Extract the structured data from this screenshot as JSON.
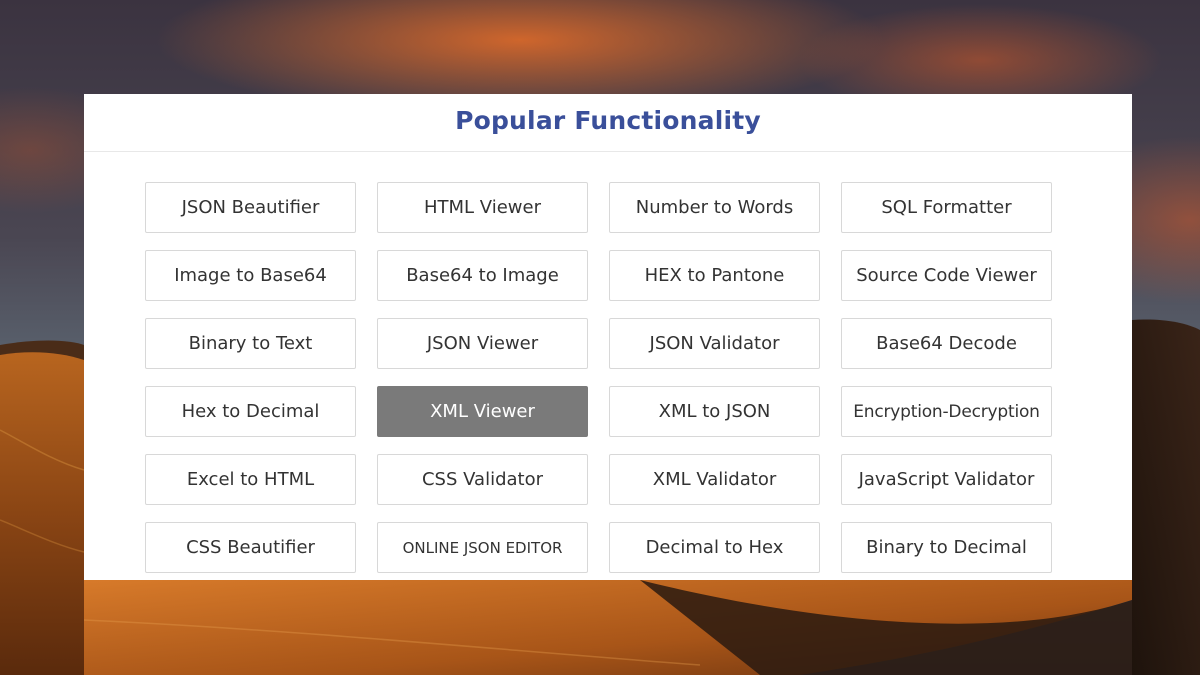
{
  "panel": {
    "title": "Popular Functionality"
  },
  "buttons": [
    {
      "label": "JSON Beautifier",
      "name": "json-beautifier-button"
    },
    {
      "label": "HTML Viewer",
      "name": "html-viewer-button"
    },
    {
      "label": "Number to Words",
      "name": "number-to-words-button"
    },
    {
      "label": "SQL Formatter",
      "name": "sql-formatter-button"
    },
    {
      "label": "Image to Base64",
      "name": "image-to-base64-button"
    },
    {
      "label": "Base64 to Image",
      "name": "base64-to-image-button"
    },
    {
      "label": "HEX to Pantone",
      "name": "hex-to-pantone-button"
    },
    {
      "label": "Source Code Viewer",
      "name": "source-code-viewer-button"
    },
    {
      "label": "Binary to Text",
      "name": "binary-to-text-button"
    },
    {
      "label": "JSON Viewer",
      "name": "json-viewer-button"
    },
    {
      "label": "JSON Validator",
      "name": "json-validator-button"
    },
    {
      "label": "Base64 Decode",
      "name": "base64-decode-button"
    },
    {
      "label": "Hex to Decimal",
      "name": "hex-to-decimal-button"
    },
    {
      "label": "XML Viewer",
      "name": "xml-viewer-button",
      "active": true
    },
    {
      "label": "XML to JSON",
      "name": "xml-to-json-button"
    },
    {
      "label": "Encryption-Decryption",
      "name": "encryption-decryption-button"
    },
    {
      "label": "Excel to HTML",
      "name": "excel-to-html-button"
    },
    {
      "label": "CSS Validator",
      "name": "css-validator-button"
    },
    {
      "label": "XML Validator",
      "name": "xml-validator-button"
    },
    {
      "label": "JavaScript Validator",
      "name": "javascript-validator-button"
    },
    {
      "label": "CSS Beautifier",
      "name": "css-beautifier-button"
    },
    {
      "label": "ONLINE JSON EDITOR",
      "name": "online-json-editor-button"
    },
    {
      "label": "Decimal to Hex",
      "name": "decimal-to-hex-button"
    },
    {
      "label": "Binary to Decimal",
      "name": "binary-to-decimal-button"
    }
  ],
  "colors": {
    "title": "#3a4f9a",
    "active_button": "#7a7a7a",
    "button_border": "#d8d8d8"
  }
}
